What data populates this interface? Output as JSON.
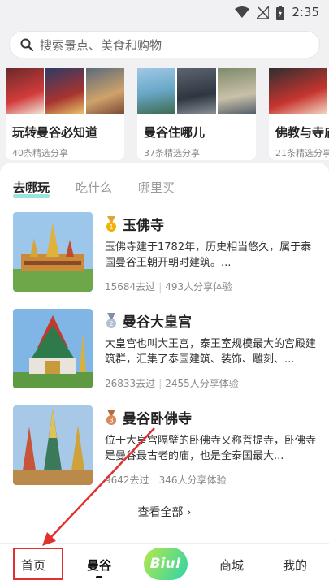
{
  "status_bar": {
    "time": "2:35"
  },
  "search": {
    "placeholder": "搜索景点、美食和购物"
  },
  "guides": [
    {
      "title": "玩转曼谷必知道",
      "subtitle": "40条精选分享"
    },
    {
      "title": "曼谷住哪儿",
      "subtitle": "37条精选分享"
    },
    {
      "title": "佛教与寺庙",
      "subtitle": "21条精选分享"
    }
  ],
  "tabs": [
    "去哪玩",
    "吃什么",
    "哪里买"
  ],
  "attractions": [
    {
      "name": "玉佛寺",
      "desc": "玉佛寺建于1782年，历史相当悠久，属于泰国曼谷王朝开朝时建筑。...",
      "visits": "15684去过",
      "shares": "493人分享体验",
      "medal_color": "#f0b400"
    },
    {
      "name": "曼谷大皇宫",
      "desc": "大皇宫也叫大王宫，泰王室规模最大的宫殿建筑群，汇集了泰国建筑、装饰、雕刻、...",
      "visits": "26833去过",
      "shares": "2455人分享体验",
      "medal_color": "#9aa9c0"
    },
    {
      "name": "曼谷卧佛寺",
      "desc": "位于大皇宫隔壁的卧佛寺又称菩提寺，卧佛寺是曼谷最古老的庙，也是全泰国最大...",
      "visits": "9642去过",
      "shares": "346人分享体验",
      "medal_color": "#d98a5a"
    }
  ],
  "view_all": "查看全部",
  "bottom_nav": {
    "home": "首页",
    "bangkok": "曼谷",
    "biu": "Biu!",
    "mall": "商城",
    "mine": "我的"
  }
}
